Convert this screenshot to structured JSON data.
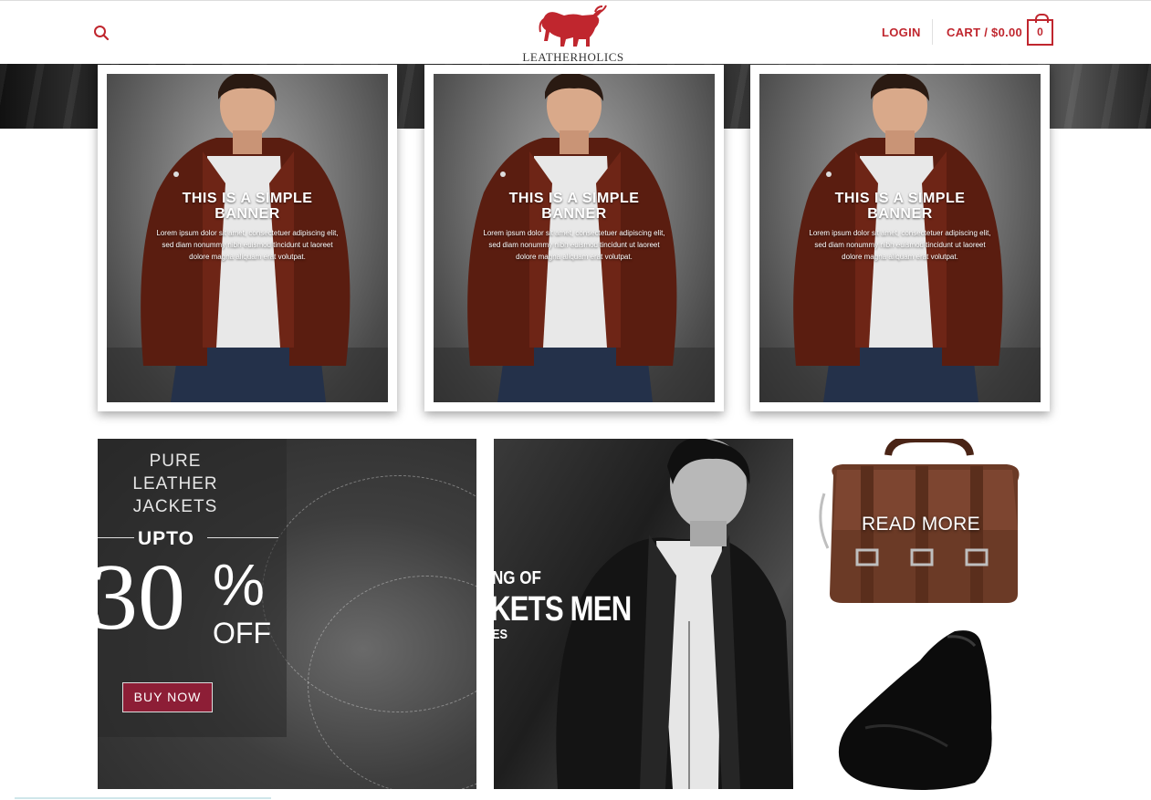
{
  "header": {
    "logo_text": "LEATHERHOLICS",
    "login_label": "LOGIN",
    "cart_label": "CART / $0.00",
    "cart_count": "0",
    "icons": [
      "search-icon",
      "bull-logo-icon",
      "cart-icon"
    ]
  },
  "colors": {
    "accent": "#c0262e",
    "buy_button": "#8d1e36"
  },
  "banners": [
    {
      "title": "THIS IS A SIMPLE BANNER",
      "body": "Lorem ipsum dolor sit amet, consectetuer adipiscing elit, sed diam nonummy nibh euismod tincidunt ut laoreet dolore magna aliquam erat volutpat."
    },
    {
      "title": "THIS IS A SIMPLE BANNER",
      "body": "Lorem ipsum dolor sit amet, consectetuer adipiscing elit, sed diam nonummy nibh euismod tincidunt ut laoreet dolore magna aliquam erat volutpat."
    },
    {
      "title": "THIS IS A SIMPLE BANNER",
      "body": "Lorem ipsum dolor sit amet, consectetuer adipiscing elit, sed diam nonummy nibh euismod tincidunt ut laoreet dolore magna aliquam erat volutpat."
    }
  ],
  "promo_jackets": {
    "line1": "PURE",
    "line2": "LEATHER",
    "line3": "JACKETS",
    "upto": "UPTO",
    "number": "30",
    "percent": "%",
    "off": "OFF",
    "button": "BUY NOW"
  },
  "promo_men": {
    "line1": "NG OF",
    "line2": "KETS MEN",
    "line3": "ES"
  },
  "bag": {
    "label": "READ MORE"
  }
}
